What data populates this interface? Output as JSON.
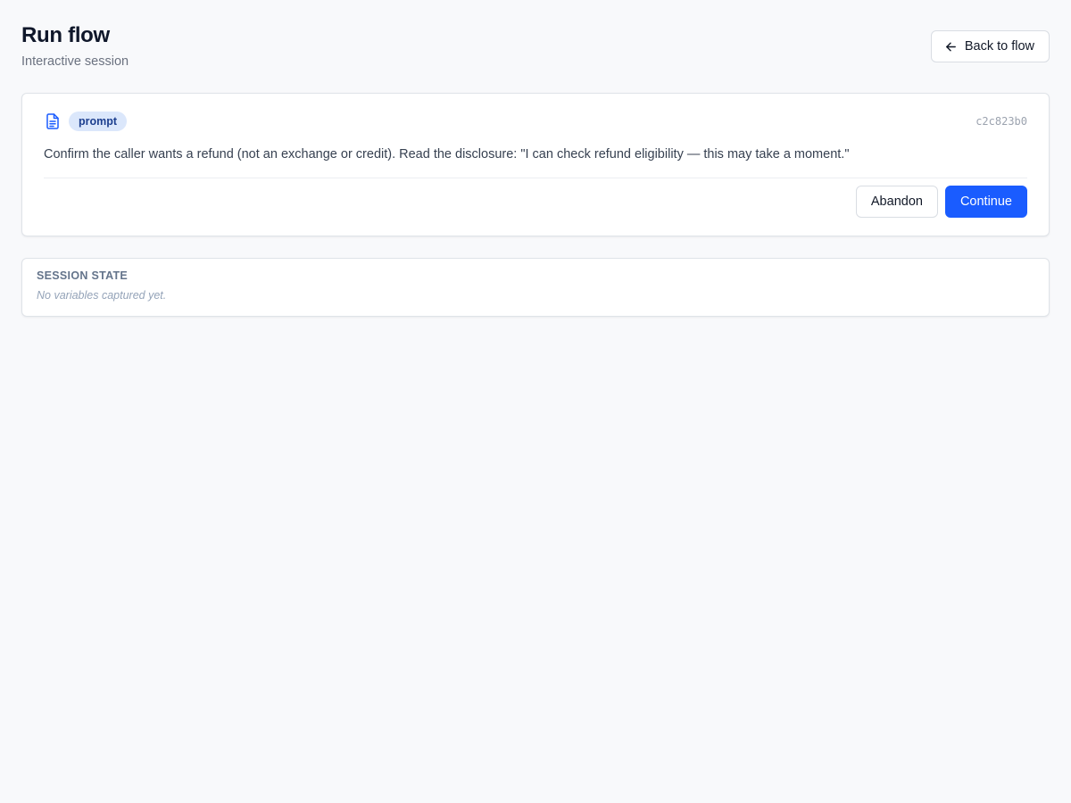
{
  "header": {
    "title": "Run flow",
    "subtitle": "Interactive session",
    "back_label": "Back to flow",
    "back_icon": "arrow-left-icon"
  },
  "step": {
    "icon": "document-icon",
    "type_badge": "prompt",
    "id": "c2c823b0",
    "text": "Confirm the caller wants a refund (not an exchange or credit). Read the disclosure: \"I can check refund eligibility — this may take a moment.\"",
    "abandon_label": "Abandon",
    "continue_label": "Continue"
  },
  "session_state": {
    "heading": "SESSION STATE",
    "empty_message": "No variables captured yet."
  },
  "colors": {
    "accent": "#1a5cff",
    "badge_bg": "#dbe7fb",
    "badge_text": "#1d3f8f",
    "page_bg": "#f8f9fb"
  }
}
